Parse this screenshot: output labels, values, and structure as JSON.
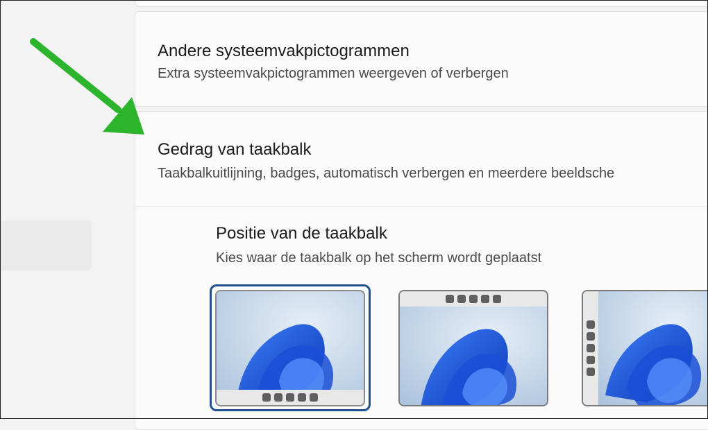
{
  "other_tray_icons": {
    "title": "Andere systeemvakpictogrammen",
    "description": "Extra systeemvakpictogrammen weergeven of verbergen"
  },
  "taskbar_behavior": {
    "title": "Gedrag van taakbalk",
    "description": "Taakbalkuitlijning, badges, automatisch verbergen en meerdere beeldsche"
  },
  "taskbar_position": {
    "title": "Positie van de taakbalk",
    "description": "Kies waar de taakbalk op het scherm wordt geplaatst",
    "options": [
      {
        "id": "bottom",
        "selected": true
      },
      {
        "id": "top",
        "selected": false
      },
      {
        "id": "left",
        "selected": false
      }
    ]
  },
  "colors": {
    "arrow": "#2db42d",
    "selected_border": "#1e4f8e",
    "wallpaper_bg": "#c9d8e8",
    "bloom": "#1f5fe0"
  },
  "icons": [
    "green-arrow-icon",
    "windows-bloom-wallpaper-icon",
    "taskbar-icon-dot"
  ]
}
